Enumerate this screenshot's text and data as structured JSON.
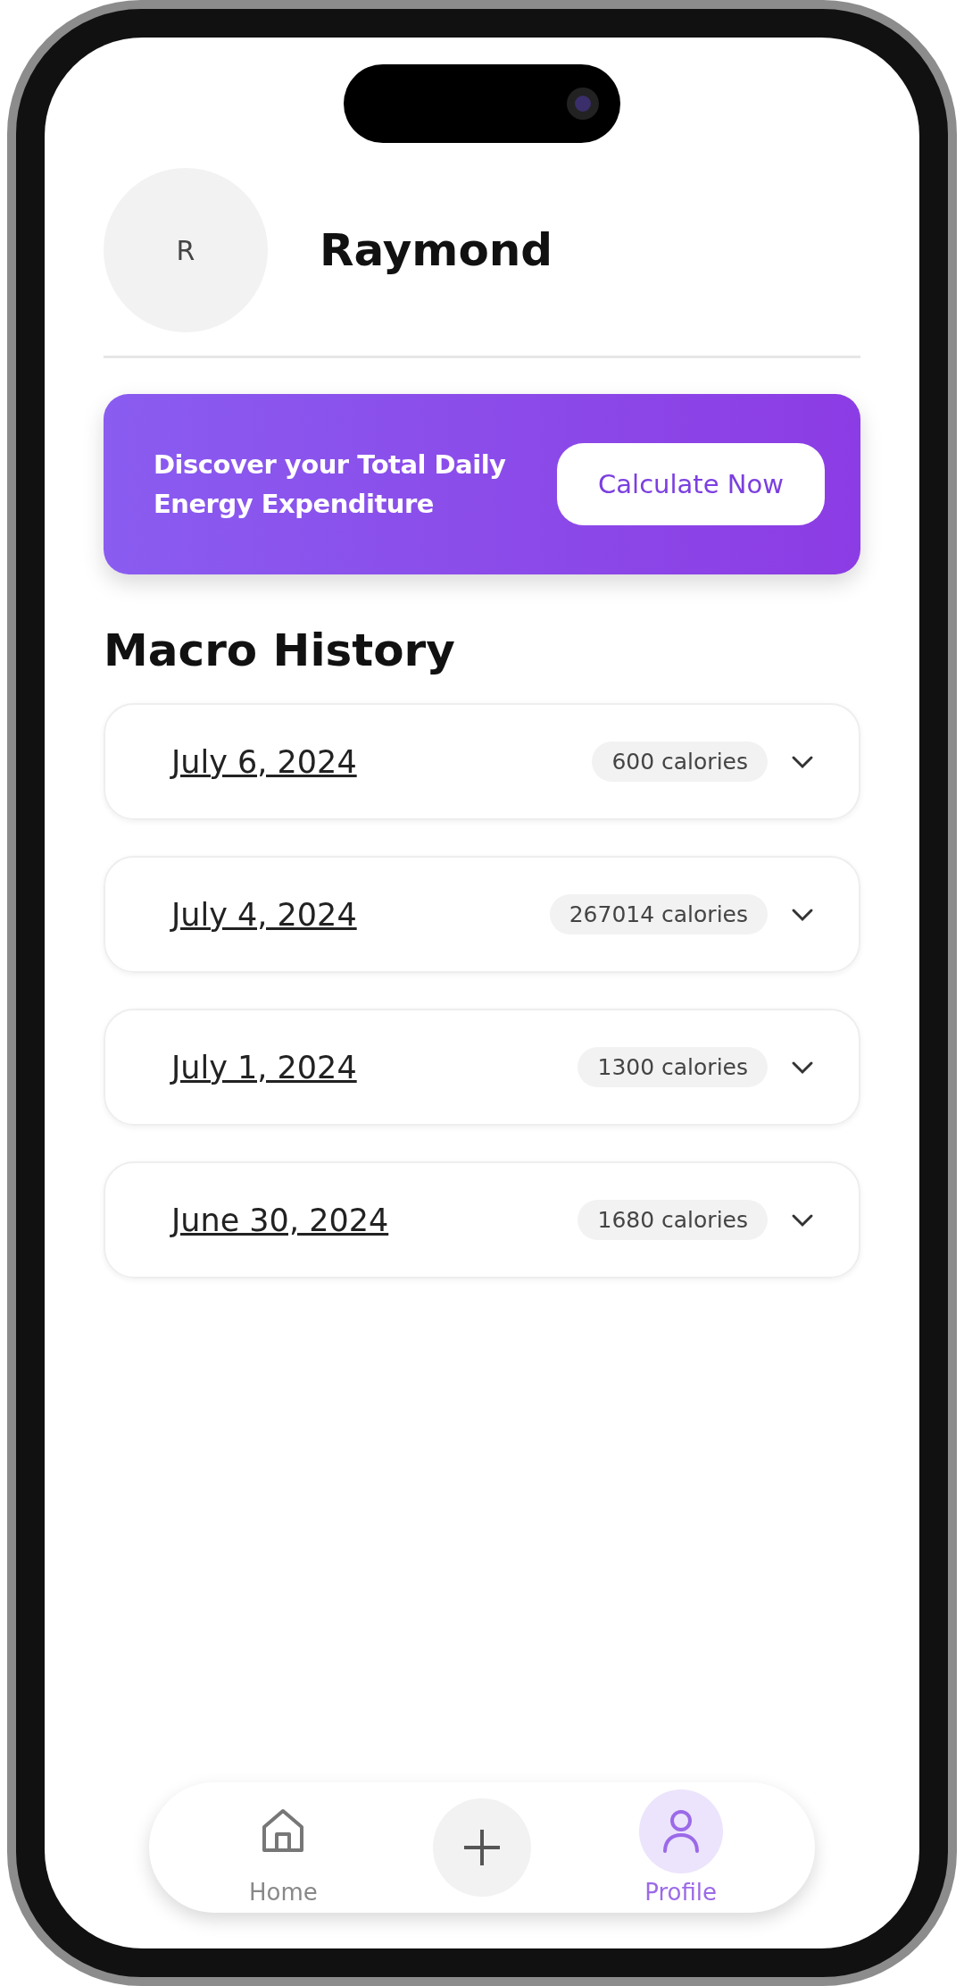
{
  "profile": {
    "initial": "R",
    "name": "Raymond"
  },
  "banner": {
    "text": "Discover your Total Daily Energy Expenditure",
    "button": "Calculate Now"
  },
  "section_title": "Macro History",
  "entries": [
    {
      "date": "July 6, 2024",
      "calories": "600 calories",
      "expanded": false
    },
    {
      "date": "July 4, 2024",
      "calories": "267014 calories",
      "expanded": false
    },
    {
      "date": "July 1, 2024",
      "calories": "1300 calories",
      "expanded": false
    },
    {
      "date": "June 30, 2024",
      "calories": "1680 calories",
      "expanded": false
    }
  ],
  "nav": [
    {
      "kind": "home",
      "label": "Home",
      "selected": false
    },
    {
      "kind": "add",
      "selected": false
    },
    {
      "kind": "profile",
      "label": "Profile",
      "selected": true
    }
  ]
}
